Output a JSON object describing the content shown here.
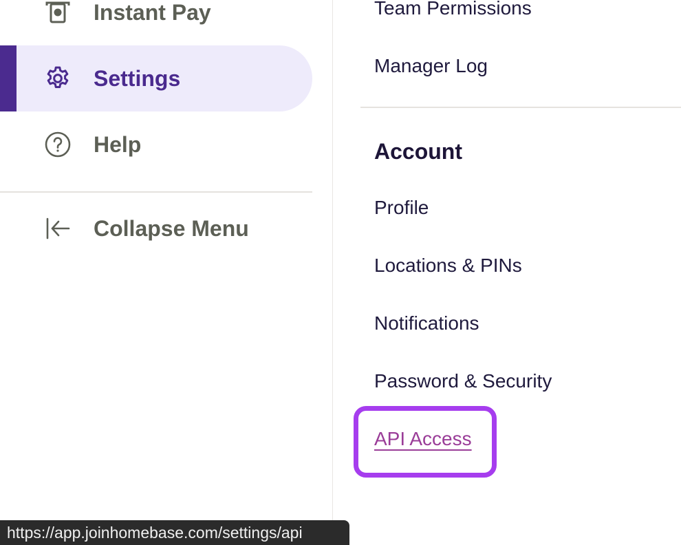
{
  "sidebar": {
    "items": [
      {
        "label": "Instant Pay",
        "icon": "instant-pay-icon"
      },
      {
        "label": "Settings",
        "icon": "gear-icon",
        "active": true
      },
      {
        "label": "Help",
        "icon": "help-circle-icon"
      },
      {
        "label": "Collapse Menu",
        "icon": "collapse-arrow-icon"
      }
    ],
    "active_color": "#4b2b8f",
    "active_bg": "#eeebfb"
  },
  "menu": {
    "team_permissions": "Team Permissions",
    "manager_log": "Manager Log",
    "section_account": "Account",
    "profile": "Profile",
    "locations_pins": "Locations & PINs",
    "notifications": "Notifications",
    "password_security": "Password & Security",
    "api_access": "API Access",
    "highlight_color": "#a63dee"
  },
  "status_bar": {
    "url": "https://app.joinhomebase.com/settings/api"
  }
}
